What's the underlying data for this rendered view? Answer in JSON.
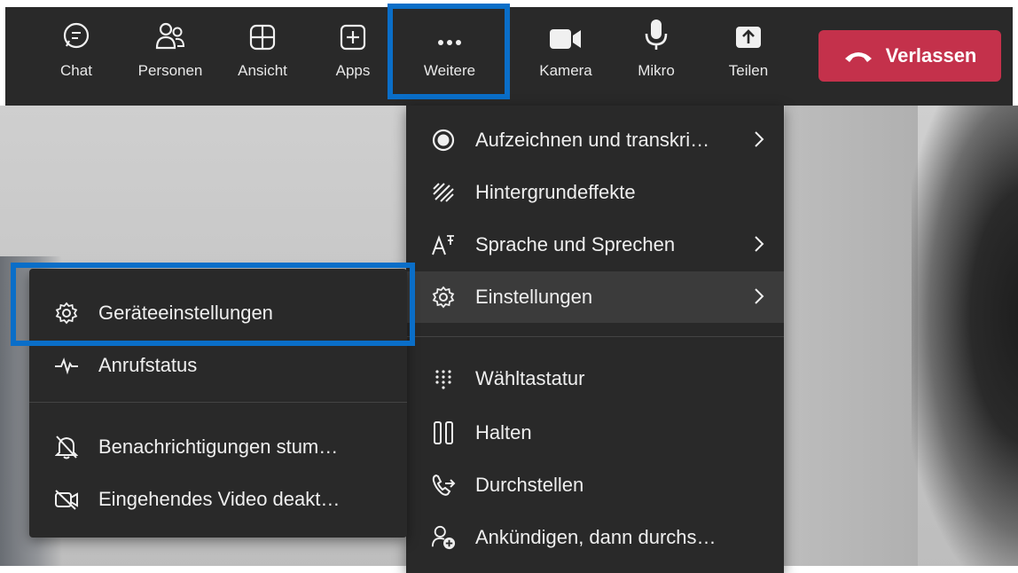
{
  "toolbar": {
    "chat": "Chat",
    "personen": "Personen",
    "ansicht": "Ansicht",
    "apps": "Apps",
    "weitere": "Weitere",
    "kamera": "Kamera",
    "mikro": "Mikro",
    "teilen": "Teilen",
    "leave": "Verlassen"
  },
  "more_menu": {
    "items": [
      {
        "label": "Aufzeichnen und transkri…",
        "icon": "record-icon",
        "submenu": true
      },
      {
        "label": "Hintergrundeffekte",
        "icon": "background-effects-icon",
        "submenu": false
      },
      {
        "label": "Sprache und Sprechen",
        "icon": "language-icon",
        "submenu": true
      },
      {
        "label": "Einstellungen",
        "icon": "gear-icon",
        "submenu": true
      },
      {
        "label": "Wähltastatur",
        "icon": "dialpad-icon",
        "submenu": false
      },
      {
        "label": "Halten",
        "icon": "hold-icon",
        "submenu": false
      },
      {
        "label": "Durchstellen",
        "icon": "transfer-icon",
        "submenu": false
      },
      {
        "label": "Ankündigen, dann durchs…",
        "icon": "consult-transfer-icon",
        "submenu": false
      }
    ]
  },
  "settings_submenu": {
    "items": [
      {
        "label": "Geräteeinstellungen",
        "icon": "gear-icon"
      },
      {
        "label": "Anrufstatus",
        "icon": "pulse-icon"
      },
      {
        "label": "Benachrichtigungen stum…",
        "icon": "bell-off-icon"
      },
      {
        "label": "Eingehendes Video deakt…",
        "icon": "video-off-icon"
      }
    ]
  },
  "colors": {
    "toolbar_bg": "#292929",
    "leave_bg": "#c4314b",
    "highlight": "#0a6ec8",
    "menu_bg": "#292929"
  }
}
